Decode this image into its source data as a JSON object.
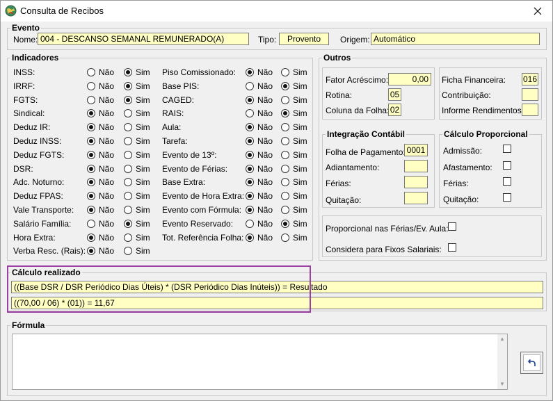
{
  "window": {
    "title": "Consulta de Recibos"
  },
  "evento": {
    "legend": "Evento",
    "nome_label": "Nome:",
    "nome_value": "004 - DESCANSO SEMANAL REMUNERADO(A)",
    "tipo_label": "Tipo:",
    "tipo_value": "Provento",
    "origem_label": "Origem:",
    "origem_value": "Automático"
  },
  "indicadores": {
    "legend": "Indicadores",
    "nao_label": "Não",
    "sim_label": "Sim",
    "left": [
      {
        "label": "INSS:",
        "value": "Sim"
      },
      {
        "label": "IRRF:",
        "value": "Sim"
      },
      {
        "label": "FGTS:",
        "value": "Sim"
      },
      {
        "label": "Sindical:",
        "value": "Não"
      },
      {
        "label": "Deduz IR:",
        "value": "Não"
      },
      {
        "label": "Deduz INSS:",
        "value": "Não"
      },
      {
        "label": "Deduz FGTS:",
        "value": "Não"
      },
      {
        "label": "DSR:",
        "value": "Não"
      },
      {
        "label": "Adc. Noturno:",
        "value": "Não"
      },
      {
        "label": "Deduz FPAS:",
        "value": "Não"
      },
      {
        "label": "Vale Transporte:",
        "value": "Não"
      },
      {
        "label": "Salário Família:",
        "value": "Sim"
      },
      {
        "label": "Hora Extra:",
        "value": "Não"
      },
      {
        "label": "Verba Resc. (Rais):",
        "value": "Não"
      }
    ],
    "right": [
      {
        "label": "Piso Comissionado:",
        "value": "Não"
      },
      {
        "label": "Base PIS:",
        "value": "Sim"
      },
      {
        "label": "CAGED:",
        "value": "Não"
      },
      {
        "label": "RAIS:",
        "value": "Sim"
      },
      {
        "label": "Aula:",
        "value": "Não"
      },
      {
        "label": "Tarefa:",
        "value": "Não"
      },
      {
        "label": "Evento de 13º:",
        "value": "Não"
      },
      {
        "label": "Evento de Férias:",
        "value": "Não"
      },
      {
        "label": "Base Extra:",
        "value": "Não"
      },
      {
        "label": "Evento de Hora Extra:",
        "value": "Não"
      },
      {
        "label": "Evento com Fórmula:",
        "value": "Não"
      },
      {
        "label": "Evento Reservado:",
        "value": "Sim"
      },
      {
        "label": "Tot. Referência Folha:",
        "value": "Não"
      }
    ]
  },
  "outros": {
    "legend": "Outros",
    "fator_label": "Fator Acréscimo:",
    "fator_value": "0,00",
    "rotina_label": "Rotina:",
    "rotina_value": "05",
    "coluna_label": "Coluna da Folha:",
    "coluna_value": "02",
    "ficha_label": "Ficha Financeira:",
    "ficha_value": "016",
    "contribuicao_label": "Contribuição:",
    "contribuicao_value": "",
    "informe_label": "Informe Rendimentos:",
    "informe_value": ""
  },
  "integracao": {
    "legend": "Integração Contábil",
    "folha_label": "Folha de Pagamento:",
    "folha_value": "0001",
    "adiantamento_label": "Adiantamento:",
    "adiantamento_value": "",
    "ferias_label": "Férias:",
    "ferias_value": "",
    "quitacao_label": "Quitação:",
    "quitacao_value": ""
  },
  "proporcional": {
    "legend": "Cálculo Proporcional",
    "items": [
      {
        "label": "Admissão:",
        "checked": false
      },
      {
        "label": "Afastamento:",
        "checked": false
      },
      {
        "label": "Férias:",
        "checked": false
      },
      {
        "label": "Quitação:",
        "checked": false
      }
    ]
  },
  "extras": {
    "proporcional_ferias_label": "Proporcional nas Férias/Ev. Aula:",
    "fixos_label": "Considera para Fixos Salariais:"
  },
  "calculo": {
    "legend": "Cálculo realizado",
    "expression": "((Base DSR / DSR Periódico Dias Úteis) * (DSR Periódico Dias Inúteis)) = Resultado",
    "result": "((70,00 / 06) * (01)) = 11,67"
  },
  "formula": {
    "legend": "Fórmula",
    "value": ""
  },
  "colors": {
    "field_bg": "#ffffc4",
    "highlight": "#9b3fa3",
    "window_bg": "#f0f0f0"
  }
}
